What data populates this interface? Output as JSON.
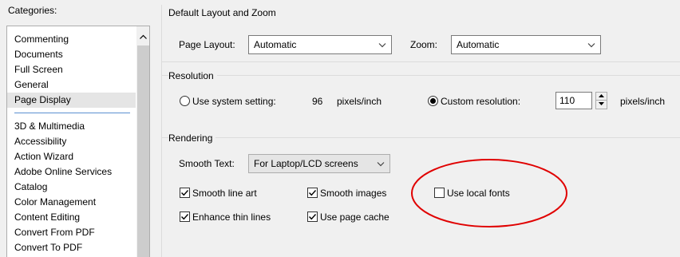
{
  "categories": {
    "label": "Categories:",
    "items_top": [
      "Commenting",
      "Documents",
      "Full Screen",
      "General",
      "Page Display"
    ],
    "items_bottom": [
      "3D & Multimedia",
      "Accessibility",
      "Action Wizard",
      "Adobe Online Services",
      "Catalog",
      "Color Management",
      "Content Editing",
      "Convert From PDF",
      "Convert To PDF"
    ],
    "selected": "Page Display"
  },
  "layout_zoom": {
    "title": "Default Layout and Zoom",
    "page_layout_label": "Page Layout:",
    "page_layout_value": "Automatic",
    "zoom_label": "Zoom:",
    "zoom_value": "Automatic"
  },
  "resolution": {
    "title": "Resolution",
    "use_system_label": "Use system setting:",
    "system_value": "96",
    "system_unit": "pixels/inch",
    "custom_label": "Custom resolution:",
    "custom_value": "110",
    "custom_unit": "pixels/inch",
    "selected": "custom"
  },
  "rendering": {
    "title": "Rendering",
    "smooth_text_label": "Smooth Text:",
    "smooth_text_value": "For Laptop/LCD screens",
    "smooth_line_art": "Smooth line art",
    "smooth_images": "Smooth images",
    "use_local_fonts": "Use local fonts",
    "enhance_thin_lines": "Enhance thin lines",
    "use_page_cache": "Use page cache",
    "checked": {
      "smooth_line_art": true,
      "smooth_images": true,
      "use_local_fonts": false,
      "enhance_thin_lines": true,
      "use_page_cache": true
    }
  },
  "annotation": {
    "color": "#e00000"
  },
  "icons": {
    "scroll_up": "chevron-up-icon",
    "dropdown": "chevron-down-icon",
    "checkmark": "checkmark-icon"
  }
}
